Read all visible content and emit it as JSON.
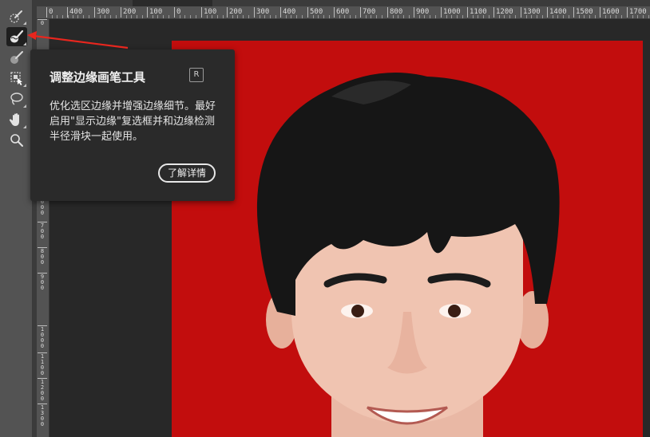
{
  "toolbar": {
    "tools": [
      {
        "id": "quick-selection",
        "icon": "quick-selection-brush-icon"
      },
      {
        "id": "refine-edge-brush",
        "icon": "refine-edge-brush-icon",
        "active": true
      },
      {
        "id": "brush",
        "icon": "brush-icon"
      },
      {
        "id": "object-selection",
        "icon": "object-selection-icon"
      },
      {
        "id": "lasso",
        "icon": "lasso-icon"
      },
      {
        "id": "hand",
        "icon": "hand-icon"
      },
      {
        "id": "zoom",
        "icon": "zoom-icon"
      }
    ]
  },
  "ruler_top": {
    "labels": [
      "0",
      "400",
      "300",
      "200",
      "100",
      "0",
      "100",
      "200",
      "300",
      "400",
      "500",
      "600",
      "700",
      "800",
      "900",
      "1000",
      "1100",
      "1200",
      "1300",
      "1400",
      "1500",
      "1600",
      "1700"
    ]
  },
  "ruler_left": {
    "labels": [
      "0",
      "6 0 0",
      "7 0 0",
      "8 0 0",
      "9 0 0",
      "1 0 0 0",
      "1 1 0 0",
      "1 2 0 0",
      "1 3 0 0"
    ]
  },
  "tooltip": {
    "title": "调整边缘画笔工具",
    "shortcut": "R",
    "description": "优化选区边缘并增强边缘细节。最好启用\"显示边缘\"复选框并和边缘检测半径滑块一起使用。",
    "learn_more": "了解详情"
  },
  "colors": {
    "background": "#c20d0d",
    "arrow": "#e8261e",
    "panel": "#2a2a2a",
    "toolbar": "#535353"
  }
}
